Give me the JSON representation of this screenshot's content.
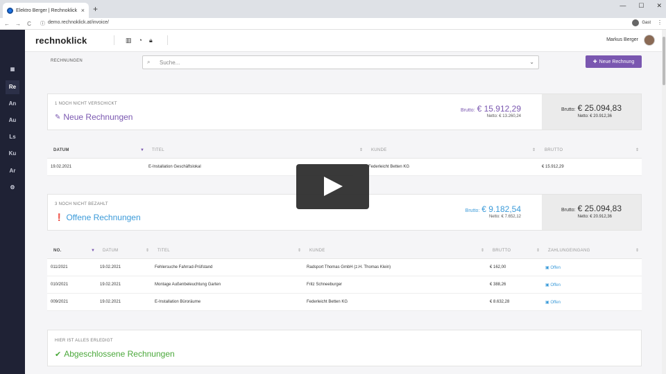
{
  "browser": {
    "tab_title": "Elektro Berger | Rechnoklick",
    "tab_close": "×",
    "new_tab": "+",
    "url": "demo.rechnoklick.at/invoice/",
    "guest_label": "Gast",
    "win_min": "—",
    "win_max": "☐",
    "win_close": "✕",
    "menu": "⋮",
    "nav_back": "←",
    "nav_forward": "→",
    "nav_reload": "C",
    "lock": "ⓘ"
  },
  "app": {
    "logo": "rechnoklick",
    "user_name": "Markus Berger",
    "breadcrumb": "RECHNUNGEN",
    "search_placeholder": "Suche...",
    "new_invoice_button": "Neue Rechnung",
    "accent": "#7a57b0"
  },
  "sidebar": {
    "items": [
      {
        "label": "▦",
        "icon": "chart-icon"
      },
      {
        "label": "Re"
      },
      {
        "label": "An"
      },
      {
        "label": "Au"
      },
      {
        "label": "Ls"
      },
      {
        "label": "Ku"
      },
      {
        "label": "Ar"
      },
      {
        "label": "⚙",
        "icon": "gear-icon"
      }
    ]
  },
  "sections": {
    "new": {
      "label": "1 NOCH NICHT VERSCHICKT",
      "title": "Neue Rechnungen",
      "brutto_label": "Brutto:",
      "brutto": "€ 15.912,29",
      "netto": "Netto: € 13.260,24",
      "total_brutto": "€ 25.094,83",
      "total_netto": "Netto: € 20.912,36",
      "color": "#7a57b0",
      "columns": [
        "DATUM",
        "TITEL",
        "KUNDE",
        "BRUTTO"
      ],
      "rows": [
        {
          "datum": "19.02.2021",
          "titel": "E-Installation Geschäftslokal",
          "kunde": "Federleicht Betten KG",
          "brutto": "€ 15.912,29"
        }
      ]
    },
    "open": {
      "label": "3 NOCH NICHT BEZAHLT",
      "title": "Offene Rechnungen",
      "brutto_label": "Brutto:",
      "brutto": "€ 9.182,54",
      "netto": "Netto: € 7.652,12",
      "total_brutto": "€ 25.094,83",
      "total_netto": "Netto: € 20.912,36",
      "color": "#3a9ad9",
      "columns": [
        "NO.",
        "DATUM",
        "TITEL",
        "KUNDE",
        "BRUTTO",
        "ZAHLUNGEINGANG"
      ],
      "rows": [
        {
          "no": "011/2021",
          "datum": "19.02.2021",
          "titel": "Fehlersuche Fahrrad-Prüfstand",
          "kunde": "Radsport Thomas GmbH (z.H. Thomas Klein)",
          "brutto": "€ 162,00",
          "status": "Offen"
        },
        {
          "no": "010/2021",
          "datum": "19.02.2021",
          "titel": "Montage Außenbeleuchtung Garten",
          "kunde": "Fritz Schneeburger",
          "brutto": "€ 388,26",
          "status": "Offen"
        },
        {
          "no": "009/2021",
          "datum": "19.02.2021",
          "titel": "E-Installation Büroräume",
          "kunde": "Federleicht Betten KG",
          "brutto": "€ 8.632,28",
          "status": "Offen"
        }
      ]
    },
    "done": {
      "label": "HIER IST ALLES ERLEDIGT",
      "title": "Abgeschlossene Rechnungen",
      "color": "#4aa83a"
    }
  }
}
